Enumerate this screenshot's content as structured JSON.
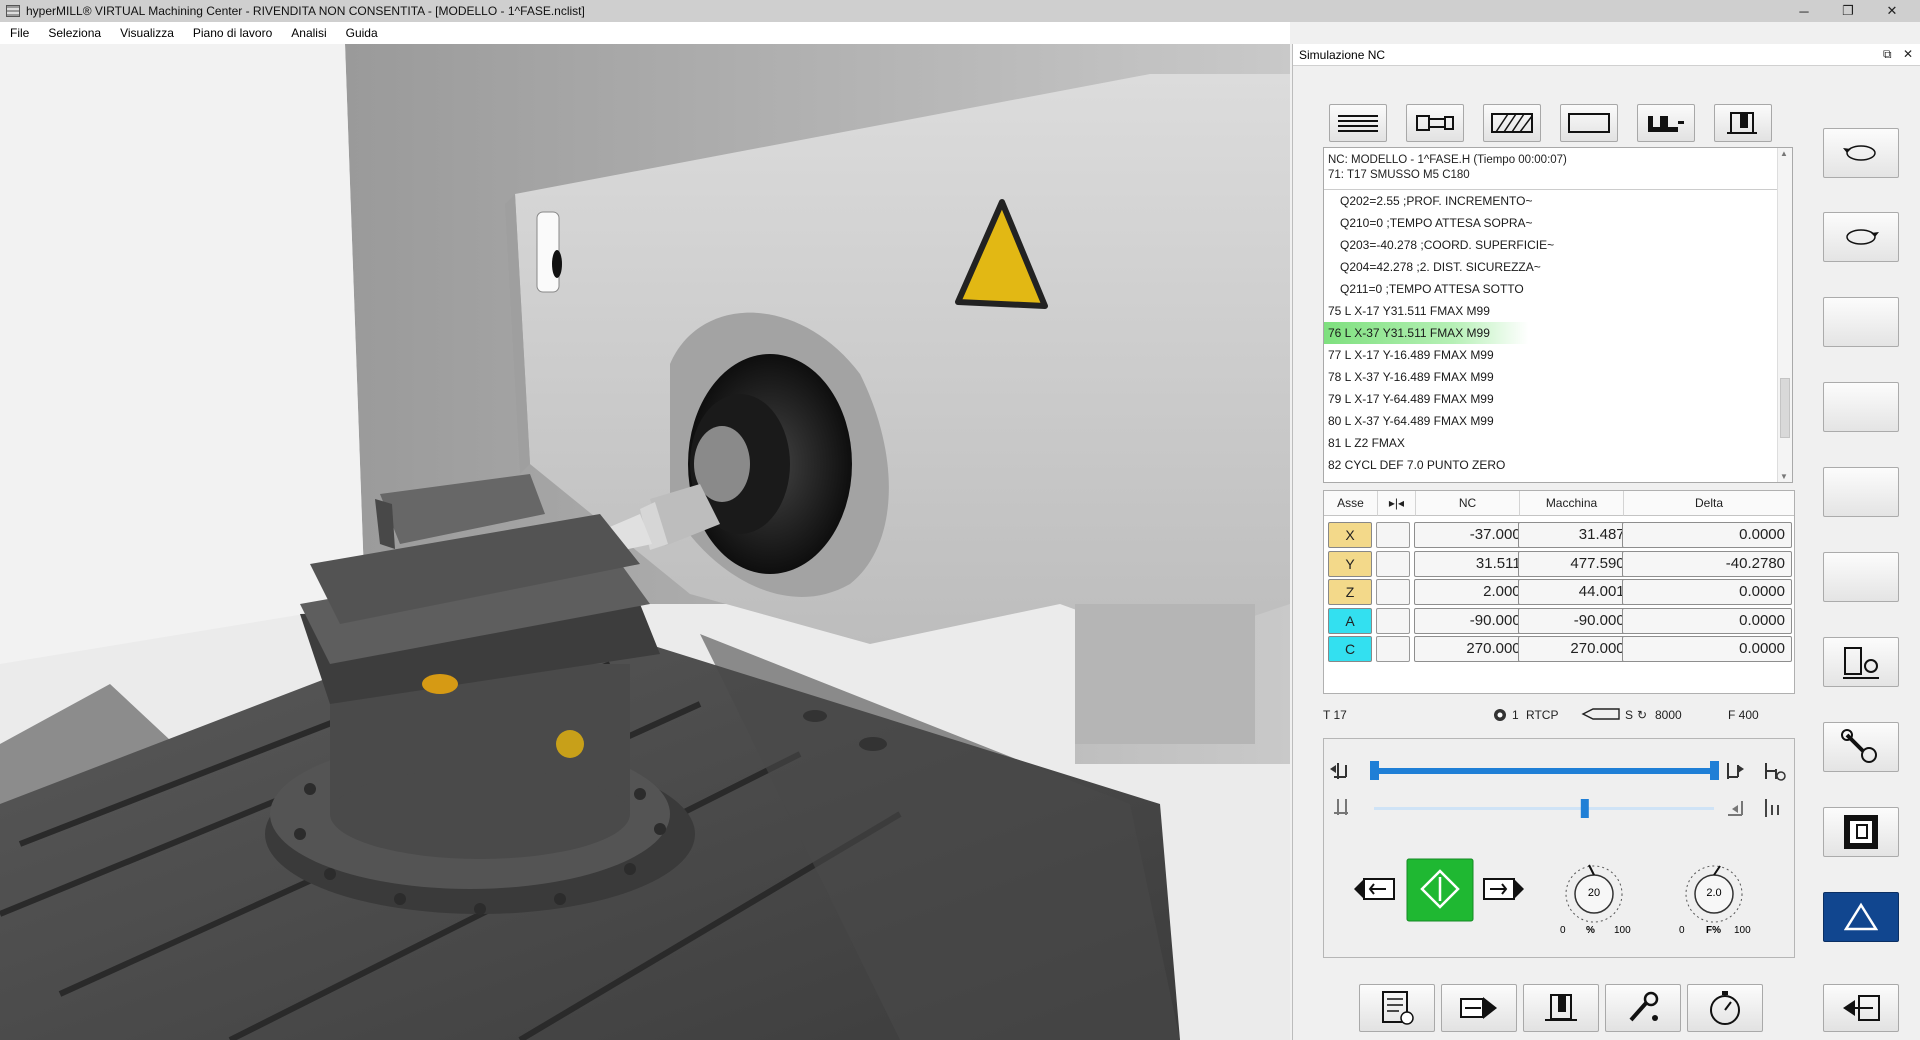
{
  "window": {
    "title": "hyperMILL® VIRTUAL Machining Center - RIVENDITA NON CONSENTITA - [MODELLO - 1^FASE.nclist]",
    "controls": [
      "─",
      "❐",
      "✕"
    ]
  },
  "menu": [
    "File",
    "Seleziona",
    "Visualizza",
    "Piano di lavoro",
    "Analisi",
    "Guida"
  ],
  "panel": {
    "title": "Simulazione NC",
    "nc_header": {
      "line1": "NC: MODELLO - 1^FASE.H (Tiempo 00:00:07)",
      "line2": "71: T17 SMUSSO M5 C180"
    },
    "nc_lines": [
      {
        "text": "Q202=2.55 ;PROF. INCREMENTO~",
        "sub": true
      },
      {
        "text": "Q210=0 ;TEMPO ATTESA SOPRA~",
        "sub": true
      },
      {
        "text": "Q203=-40.278 ;COORD. SUPERFICIE~",
        "sub": true
      },
      {
        "text": "Q204=42.278 ;2. DIST. SICUREZZA~",
        "sub": true
      },
      {
        "text": "Q211=0 ;TEMPO ATTESA SOTTO",
        "sub": true
      },
      {
        "text": "75 L X-17 Y31.511 FMAX M99",
        "sub": false
      },
      {
        "text": "76 L X-37 Y31.511 FMAX M99",
        "sub": false,
        "current": true
      },
      {
        "text": "77 L X-17 Y-16.489 FMAX M99",
        "sub": false
      },
      {
        "text": "78 L X-37 Y-16.489 FMAX M99",
        "sub": false
      },
      {
        "text": "79 L X-17 Y-64.489 FMAX M99",
        "sub": false
      },
      {
        "text": "80 L X-37 Y-64.489 FMAX M99",
        "sub": false
      },
      {
        "text": "81 L Z2 FMAX",
        "sub": false
      },
      {
        "text": "82 CYCL DEF 7.0 PUNTO ZERO",
        "sub": false
      }
    ],
    "axes_table": {
      "headers": [
        "Asse",
        "▸|◂",
        "NC",
        "Macchina",
        "Delta"
      ],
      "rows": [
        {
          "axis": "X",
          "color": "#f3d98a",
          "nc": "-37.0000",
          "machine": "31.4876",
          "delta": "0.0000"
        },
        {
          "axis": "Y",
          "color": "#f3d98a",
          "nc": "31.5110",
          "machine": "477.5906",
          "delta": "-40.2780"
        },
        {
          "axis": "Z",
          "color": "#f3d98a",
          "nc": "2.0000",
          "machine": "44.0017",
          "delta": "0.0000"
        },
        {
          "axis": "A",
          "color": "#33e0f0",
          "nc": "-90.0000",
          "machine": "-90.0000",
          "delta": "0.0000"
        },
        {
          "axis": "C",
          "color": "#33e0f0",
          "nc": "270.0000",
          "machine": "270.0000",
          "delta": "0.0000"
        }
      ]
    },
    "status": {
      "tool": "T 17",
      "plane": "1",
      "rtcp": "RTCP",
      "spindle_label": "S",
      "spindle": "8000",
      "feed": "F 400"
    },
    "controls": {
      "progress": 1.0,
      "speed_slider": 0.62,
      "dial1": {
        "value": "20",
        "min": "0",
        "max": "100",
        "label": "%"
      },
      "dial2": {
        "value": "2.0",
        "min": "0",
        "max": "100",
        "label": "F%"
      },
      "play_color": "#1fb832"
    }
  },
  "colors": {
    "accent_blue": "#1f7fd6",
    "warning_button": "#11468f",
    "highlight_green": "#7ee07e"
  }
}
